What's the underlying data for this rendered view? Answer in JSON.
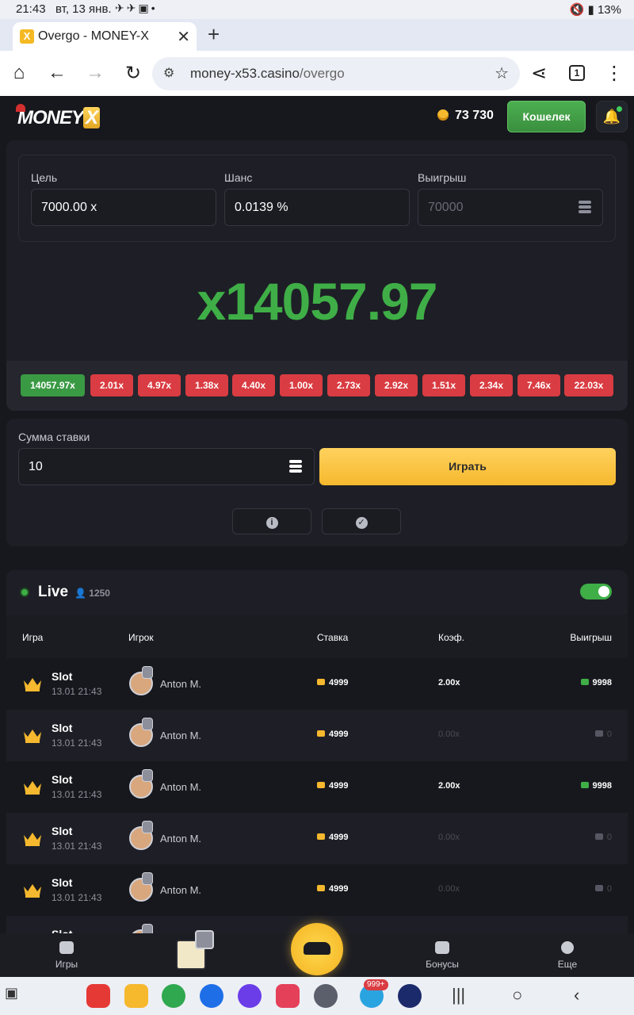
{
  "status": {
    "time": "21:43",
    "date": "вт, 13 янв.",
    "battery": "13%"
  },
  "browser": {
    "tab_title": "Overgo - MONEY-X",
    "url_host": "money-x53.casino",
    "url_path": "/overgo",
    "tab_count": "1"
  },
  "header": {
    "logo_text": "MONEY",
    "logo_x": "X",
    "balance": "73 730",
    "wallet_label": "Кошелек"
  },
  "game": {
    "target_label": "Цель",
    "target_value": "7000.00 x",
    "chance_label": "Шанс",
    "chance_value": "0.0139 %",
    "win_label": "Выигрыш",
    "win_value": "70000",
    "multiplier": "x14057.97",
    "history": [
      "14057.97x",
      "2.01x",
      "4.97x",
      "1.38x",
      "4.40x",
      "1.00x",
      "2.73x",
      "2.92x",
      "1.51x",
      "2.34x",
      "7.46x",
      "22.03x"
    ]
  },
  "bet": {
    "label": "Сумма ставки",
    "amount": "10",
    "play_label": "Играть"
  },
  "live": {
    "title": "Live",
    "online": "1250",
    "columns": {
      "game": "Игра",
      "player": "Игрок",
      "stake": "Ставка",
      "coef": "Коэф.",
      "payout": "Выигрыш"
    },
    "rows": [
      {
        "game": "Slot",
        "time": "13.01 21:43",
        "player": "Anton M.",
        "stake": "4999",
        "coef": "2.00x",
        "payout": "9998"
      },
      {
        "game": "Slot",
        "time": "13.01 21:43",
        "player": "Anton M.",
        "stake": "4999",
        "coef": "0.00x",
        "payout": "0"
      },
      {
        "game": "Slot",
        "time": "13.01 21:43",
        "player": "Anton M.",
        "stake": "4999",
        "coef": "2.00x",
        "payout": "9998"
      },
      {
        "game": "Slot",
        "time": "13.01 21:43",
        "player": "Anton M.",
        "stake": "4999",
        "coef": "0.00x",
        "payout": "0"
      },
      {
        "game": "Slot",
        "time": "13.01 21:43",
        "player": "Anton M.",
        "stake": "4999",
        "coef": "0.00x",
        "payout": "0"
      },
      {
        "game": "Slot",
        "time": "",
        "player": "",
        "stake": "",
        "coef": "",
        "payout": ""
      }
    ]
  },
  "bottomnav": {
    "games": "Игры",
    "bonuses": "Бонусы",
    "more": "Еще"
  },
  "android": {
    "telegram_badge": "999+"
  },
  "colors": {
    "win_green": "#3fae47",
    "loss_red": "#d93c42",
    "accent_yellow": "#f6b82d"
  }
}
